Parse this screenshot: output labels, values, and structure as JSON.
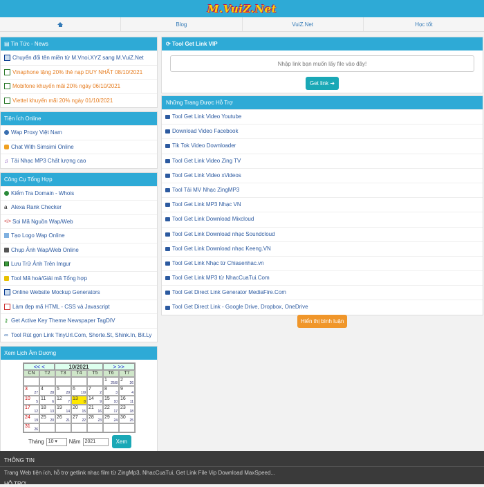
{
  "header": {
    "logo": "M.VuiZ.Net"
  },
  "nav": {
    "items": [
      "",
      "Blog",
      "VuiZ.Net",
      "Học tốt"
    ]
  },
  "news": {
    "title": "Tin Tức - News",
    "items": [
      {
        "label": "Chuyển đổi tên miền từ M.Vnoi.XYZ sang M.VuiZ.Net",
        "color": "blue"
      },
      {
        "label": "Vinaphone tặng 20% thẻ nạp DUY NHẤT 08/10/2021",
        "color": "orange"
      },
      {
        "label": "Mobifone khuyến mãi 20% ngày 06/10/2021",
        "color": "orange"
      },
      {
        "label": "Viettel khuyến mãi 20% ngày 01/10/2021",
        "color": "orange"
      }
    ]
  },
  "online": {
    "title": "Tiện Ích Online",
    "items": [
      "Wap Proxy Việt Nam",
      "Chat With Simsimi Online",
      "Tải Nhạc MP3 Chất lượng cao"
    ]
  },
  "tools": {
    "title": "Công Cụ Tổng Hợp",
    "items": [
      "Kiểm Tra Domain - Whois",
      "Alexa Rank Checker",
      "Soi Mã Nguồn Wap/Web",
      "Tạo Logo Wap Online",
      "Chụp Ảnh Wap/Web Online",
      "Lưu Trữ Ảnh Trên Imgur",
      "Tool Mã hoá/Giải mã Tổng hợp",
      "Online Website Mockup Generators",
      "Làm đẹp mã HTML - CSS và Javascript",
      "Get Active Key Theme Newspaper TagDIV",
      "Tool Rút gọn Link TinyUrl.Com, Shorte.St, Shink.In, Bit.Ly"
    ]
  },
  "calendar": {
    "title": "Xem Lịch Âm Dương",
    "prev": "<< <",
    "month_label": "10/2021",
    "next": "> >>",
    "dow": [
      "CN",
      "T2",
      "T3",
      "T4",
      "T5",
      "T6",
      "T7"
    ],
    "month_label_ctrl": "Tháng",
    "month_value": "10",
    "year_label": "Năm",
    "year_value": "2021",
    "submit": "Xem"
  },
  "vip": {
    "title": "Tool Get Link VIP",
    "placeholder": "Nhập link bạn muốn lấy file vào đây!",
    "button": "Get link"
  },
  "supported": {
    "title": "Những Trang Được Hỗ Trợ",
    "items": [
      "Tool Get Link Video Youtube",
      "Download Video Facebook",
      "Tik Tok Video Downloader",
      "Tool Get Link Video Zing TV",
      "Tool Get Link Video xVideos",
      "Tool Tải MV Nhạc ZingMP3",
      "Tool Get Link MP3 Nhạc VN",
      "Tool Get Link Download Mixcloud",
      "Tool Get Link Download nhạc Soundcloud",
      "Tool Get Link Download nhạc Keeng.VN",
      "Tool Get Link Nhạc từ Chiasenhac.vn",
      "Tool Get Link MP3 từ NhacCuaTui.Com",
      "Tool Get Direct Link Generator MediaFire.Com",
      "Tool Get Direct Link - Google Drive, Dropbox, OneDrive"
    ]
  },
  "comments_button": "Hiển thị bình luận",
  "footer": {
    "title": "THÔNG TIN",
    "text": "Trang Web tiện ích, hỗ trợ getlink nhạc film từ ZingMp3, NhacCuaTui, Get Link File Vip Download MaxSpeed...",
    "title2": "HỖ TRỢ"
  }
}
